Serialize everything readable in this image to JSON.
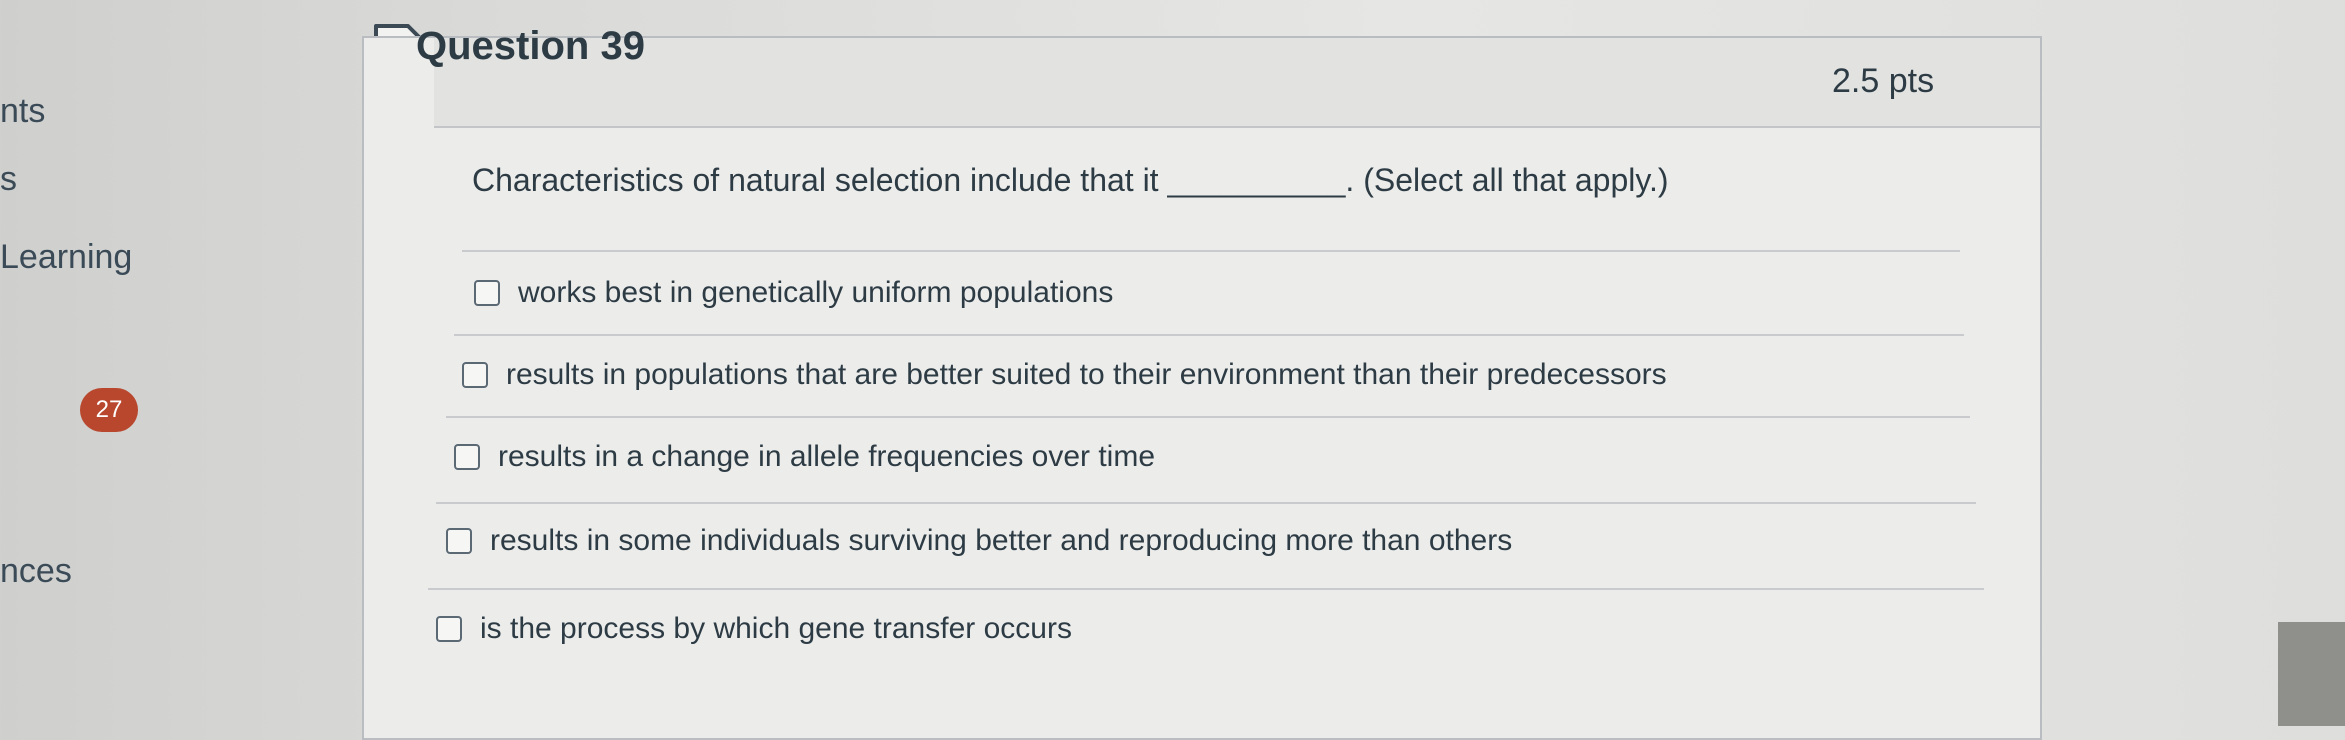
{
  "sidebar": {
    "items": [
      "nts",
      "s",
      "Learning",
      "nces"
    ],
    "badge": "27"
  },
  "question": {
    "title": "Question 39",
    "points": "2.5 pts",
    "prompt": "Characteristics of natural selection include that it __________. (Select all that apply.)",
    "options": [
      "works best in genetically uniform populations",
      "results in populations that are better suited to their environment than their predecessors",
      "results in a change in allele frequencies over time",
      "results in some individuals surviving better and reproducing more than others",
      "is the process by which gene transfer occurs"
    ]
  },
  "colors": {
    "badge": "#b8472d",
    "text": "#2d3b45",
    "border": "#b9bcc0"
  },
  "icons": [
    "bookmark-flag-icon",
    "checkbox-icon"
  ]
}
